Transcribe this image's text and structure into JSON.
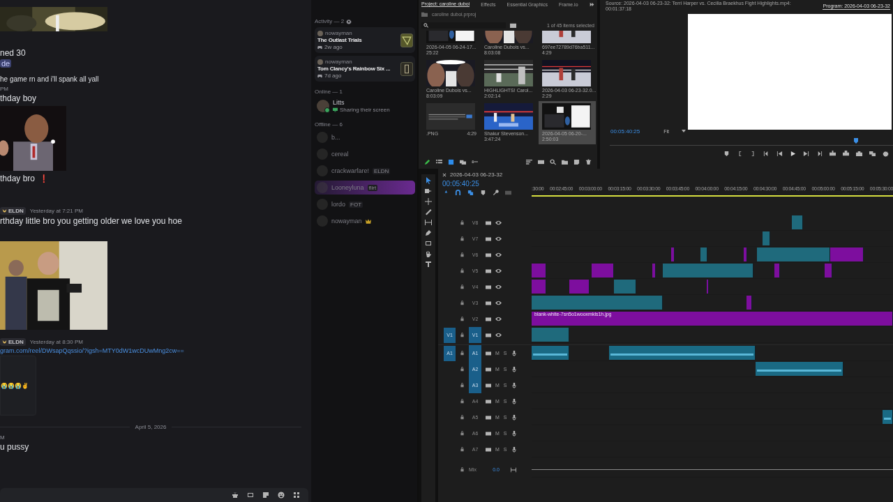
{
  "chat": {
    "messages": [
      {
        "kind": "picture"
      },
      {
        "kind": "text",
        "text": "ned 30"
      },
      {
        "kind": "mention",
        "text": "de"
      },
      {
        "kind": "small",
        "text": "he game rn and i'll spank all yall"
      },
      {
        "kind": "time",
        "text": "PM"
      },
      {
        "kind": "text",
        "text": "thday boy"
      },
      {
        "kind": "picture"
      },
      {
        "kind": "text",
        "text": "thday bro",
        "emoji": "❗"
      },
      {
        "kind": "header",
        "tag": "ELDN",
        "time": "Yesterday at 7:21 PM"
      },
      {
        "kind": "text",
        "text": "rthday little bro you getting older we love you hoe"
      },
      {
        "kind": "picture"
      },
      {
        "kind": "header",
        "tag": "ELDN",
        "time": "Yesterday at 8:30 PM"
      },
      {
        "kind": "link",
        "text": "gram.com/reel/DWsapQqssio/?igsh=MTY0dW1wcDUwMng2cw=="
      },
      {
        "kind": "embed",
        "text": "😭😭😭✌"
      },
      {
        "kind": "divider",
        "text": "April 5, 2026"
      },
      {
        "kind": "time",
        "text": "M"
      },
      {
        "kind": "text",
        "text": "u pussy"
      }
    ]
  },
  "members": {
    "activity_heading": "Activity — 2",
    "activities": [
      {
        "user": "nowayman",
        "game": "The Outlast Trials",
        "ago": "2w ago"
      },
      {
        "user": "nowayman",
        "game": "Tom Clancy's Rainbow Six ...",
        "ago": "7d ago"
      }
    ],
    "online_heading": "Online — 1",
    "online": [
      {
        "name": "Litts",
        "status": "Sharing their screen"
      }
    ],
    "offline_heading": "Offline — 6",
    "offline": [
      {
        "name": "b...",
        "highlighted": false,
        "owner": false
      },
      {
        "name": "cereal",
        "highlighted": false,
        "owner": false
      },
      {
        "name": "crackwarfare!",
        "tag": "ELDN",
        "highlighted": false,
        "owner": false
      },
      {
        "name": "Looneyluna",
        "tag": "flirt",
        "highlighted": true,
        "owner": false
      },
      {
        "name": "lordo",
        "tag": "FOT",
        "highlighted": false,
        "owner": false
      },
      {
        "name": "nowayman",
        "highlighted": false,
        "owner": true
      }
    ]
  },
  "project": {
    "tabs": [
      {
        "label": "Project: caroline duboi",
        "selected": true
      },
      {
        "label": "Effects",
        "selected": false
      },
      {
        "label": "Essential Graphics",
        "selected": false
      },
      {
        "label": "Frame.io",
        "selected": false
      }
    ],
    "file": "caroline duboi.prproj",
    "count": "1 of 45 items selected",
    "items": [
      {
        "name": "2026-04-05 06-24-17...",
        "duration": "25:22",
        "selected": false
      },
      {
        "name": "Caroline Dubois vs...",
        "duration": "8:03:08",
        "selected": false
      },
      {
        "name": "697ee72789d76ba511...",
        "duration": "4:29",
        "selected": false
      },
      {
        "name": "Caroline Dubois vs...",
        "duration": "8:03:09",
        "selected": false
      },
      {
        "name": "HIGHLIGHTS! Carol...",
        "duration": "2:02:14",
        "selected": false
      },
      {
        "name": "2026-04-03 06-23-32.0...",
        "duration": "2:29",
        "selected": false
      },
      {
        "name": ".PNG",
        "duration": "4:29",
        "selected": false
      },
      {
        "name": "Shakur Stevenson...",
        "duration": "3:47:24",
        "selected": false
      },
      {
        "name": "2026-04-05 06-20-...",
        "duration": "2:50:03",
        "selected": true
      }
    ]
  },
  "monitor": {
    "source_tab": "Source: 2026-04-03 06-23-32: Terri Harper vs. Cecilia Braekhus  Fight Highlights.mp4: 00:01:37:18",
    "program_tab": "Program: 2026-04-03 06-23-32",
    "timecode": "00:05:40:25",
    "zoom": "Fit"
  },
  "timeline": {
    "title": "2026-04-03 06-23-32",
    "timecode": "00:05:40:25",
    "ruler": [
      ":30:00",
      "00:02:45:00",
      "00:03:00:00",
      "00:03:15:00",
      "00:03:30:00",
      "00:03:45:00",
      "00:04:00:00",
      "00:04:15:00",
      "00:04:30:00",
      "00:04:45:00",
      "00:05:00:00",
      "00:05:15:00",
      "00:05:30:00"
    ],
    "clip_label": "blank-white-7sn5o1wooxmkls1h.jpg",
    "tracks": [
      {
        "kind": "video",
        "name": "V8",
        "targeted": false
      },
      {
        "kind": "video",
        "name": "V7",
        "targeted": false
      },
      {
        "kind": "video",
        "name": "V6",
        "targeted": false
      },
      {
        "kind": "video",
        "name": "V5",
        "targeted": false
      },
      {
        "kind": "video",
        "name": "V4",
        "targeted": false
      },
      {
        "kind": "video",
        "name": "V3",
        "targeted": false
      },
      {
        "kind": "video",
        "name": "V2",
        "targeted": false
      },
      {
        "kind": "video",
        "name": "V1",
        "targeted": true,
        "source": "V1"
      },
      {
        "kind": "audio",
        "name": "A1",
        "targeted": true,
        "source": "A1",
        "mute": "M",
        "solo": "S"
      },
      {
        "kind": "audio",
        "name": "A2",
        "targeted": true,
        "mute": "M",
        "solo": "S"
      },
      {
        "kind": "audio",
        "name": "A3",
        "targeted": true,
        "mute": "M",
        "solo": "S"
      },
      {
        "kind": "audio",
        "name": "A4",
        "targeted": false,
        "mute": "M",
        "solo": "S"
      },
      {
        "kind": "audio",
        "name": "A5",
        "targeted": false,
        "mute": "M",
        "solo": "S"
      },
      {
        "kind": "audio",
        "name": "A6",
        "targeted": false,
        "mute": "M",
        "solo": "S"
      },
      {
        "kind": "audio",
        "name": "A7",
        "targeted": false,
        "mute": "M",
        "solo": "S"
      }
    ],
    "mix": {
      "name": "Mix",
      "value": "0.0"
    }
  }
}
